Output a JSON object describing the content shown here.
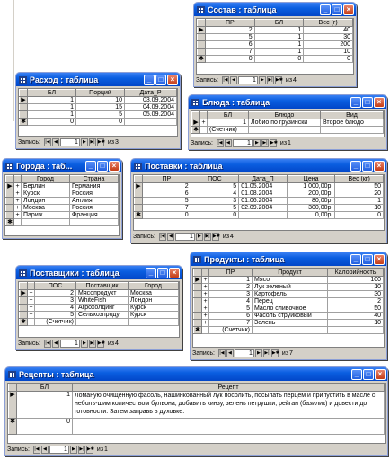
{
  "common": {
    "record_label": "Запись:",
    "of": "из"
  },
  "sostav": {
    "title": "Состав : таблица",
    "headers": [
      "ПР",
      "БЛ",
      "Вес (г)"
    ],
    "rows": [
      [
        "2",
        "1",
        "40"
      ],
      [
        "5",
        "1",
        "30"
      ],
      [
        "6",
        "1",
        "200"
      ],
      [
        "7",
        "1",
        "10"
      ],
      [
        "0",
        "0",
        "0"
      ]
    ],
    "record": "1",
    "count": "4"
  },
  "rashod": {
    "title": "Расход : таблица",
    "headers": [
      "БЛ",
      "Порций",
      "Дата_Р"
    ],
    "rows": [
      [
        "1",
        "10",
        "03.09.2004"
      ],
      [
        "1",
        "15",
        "04.09.2004"
      ],
      [
        "1",
        "5",
        "05.09.2004"
      ],
      [
        "0",
        "0",
        ""
      ]
    ],
    "record": "1",
    "count": "3"
  },
  "blyuda": {
    "title": "Блюда : таблица",
    "headers": [
      "БЛ",
      "Блюдо",
      "Вид"
    ],
    "rows": [
      [
        "1",
        "Лобио по грузински",
        "Второе блюдо"
      ],
      [
        "(Счетчик)",
        "",
        ""
      ]
    ],
    "record": "1",
    "count": "1"
  },
  "goroda": {
    "title": "Города : таб...",
    "headers": [
      "Город",
      "Страна"
    ],
    "rows": [
      [
        "Берлин",
        "Германия"
      ],
      [
        "Курск",
        "Россия"
      ],
      [
        "Лондон",
        "Англия"
      ],
      [
        "Москва",
        "Россия"
      ],
      [
        "Париж",
        "Франция"
      ]
    ]
  },
  "postavki": {
    "title": "Поставки : таблица",
    "headers": [
      "ПР",
      "ПОС",
      "Дата_П",
      "Цена",
      "Вес (кг)"
    ],
    "rows": [
      [
        "2",
        "5",
        "01.05.2004",
        "1 000,00р.",
        "50"
      ],
      [
        "6",
        "4",
        "01.08.2004",
        "200,00р.",
        "20"
      ],
      [
        "5",
        "3",
        "01.06.2004",
        "80,00р.",
        "1"
      ],
      [
        "7",
        "5",
        "02.09.2004",
        "300,00р.",
        "10"
      ],
      [
        "0",
        "0",
        "",
        "0,00р.",
        "0"
      ]
    ],
    "record": "1",
    "count": "4"
  },
  "postavshchiki": {
    "title": "Поставщики : таблица",
    "headers": [
      "ПОС",
      "Поставщик",
      "Город"
    ],
    "rows": [
      [
        "2",
        "Мясопродукт",
        "Москва"
      ],
      [
        "3",
        "WhiteFish",
        "Лондон"
      ],
      [
        "4",
        "Агрохолдинг",
        "Курск"
      ],
      [
        "5",
        "Сельхозпроду",
        "Курск"
      ],
      [
        "(Счетчик)",
        "",
        ""
      ]
    ],
    "record": "1",
    "count": "4"
  },
  "produkty": {
    "title": "Продукты : таблица",
    "headers": [
      "ПР",
      "Продукт",
      "Калорийность"
    ],
    "rows": [
      [
        "1",
        "Мясо",
        "100"
      ],
      [
        "2",
        "Лук зеленый",
        "10"
      ],
      [
        "3",
        "Картофель",
        "30"
      ],
      [
        "4",
        "Перец",
        "2"
      ],
      [
        "5",
        "Масло сливочное",
        "50"
      ],
      [
        "6",
        "Фасоль струйковый",
        "40"
      ],
      [
        "7",
        "Зелень",
        "10"
      ],
      [
        "(Счетчик)",
        "",
        ""
      ]
    ],
    "record": "1",
    "count": "7"
  },
  "recepty": {
    "title": "Рецепты : таблица",
    "headers": [
      "БЛ",
      "Рецепт"
    ],
    "rows": [
      [
        "1",
        "Ломаную очищенную фасоль, нашинкованный лук посолить, посыпать перцем и припустить в масле с неболь-шим количеством бульона; добавить кинзу, зелень петрушки, рейган (базилик) и довести до готовности. Затем заправь в духовке."
      ],
      [
        "0",
        ""
      ]
    ],
    "record": "1",
    "count": "1"
  }
}
